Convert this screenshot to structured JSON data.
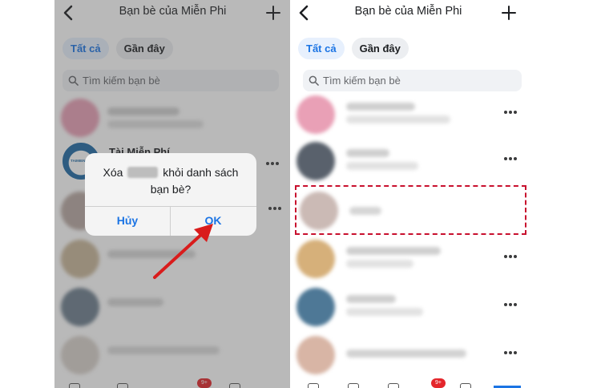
{
  "header": {
    "title": "Bạn bè của Miễn Phi"
  },
  "filters": {
    "all_label": "Tất cả",
    "recent_label": "Gần đây"
  },
  "search": {
    "placeholder": "Tìm kiếm bạn bè"
  },
  "friend_list": {
    "visible_name_fragment": "Tài Miễn Phí",
    "logo_text": "TAIMIENPHI"
  },
  "dialog": {
    "message_prefix": "Xóa",
    "message_suffix": "khỏi danh sách bạn bè?",
    "cancel_label": "Hủy",
    "ok_label": "OK"
  },
  "tabbar": {
    "badge_count": "9+"
  },
  "colors": {
    "accent": "#1b74e4",
    "highlight": "#c8102e",
    "arrow": "#d91c1c"
  }
}
